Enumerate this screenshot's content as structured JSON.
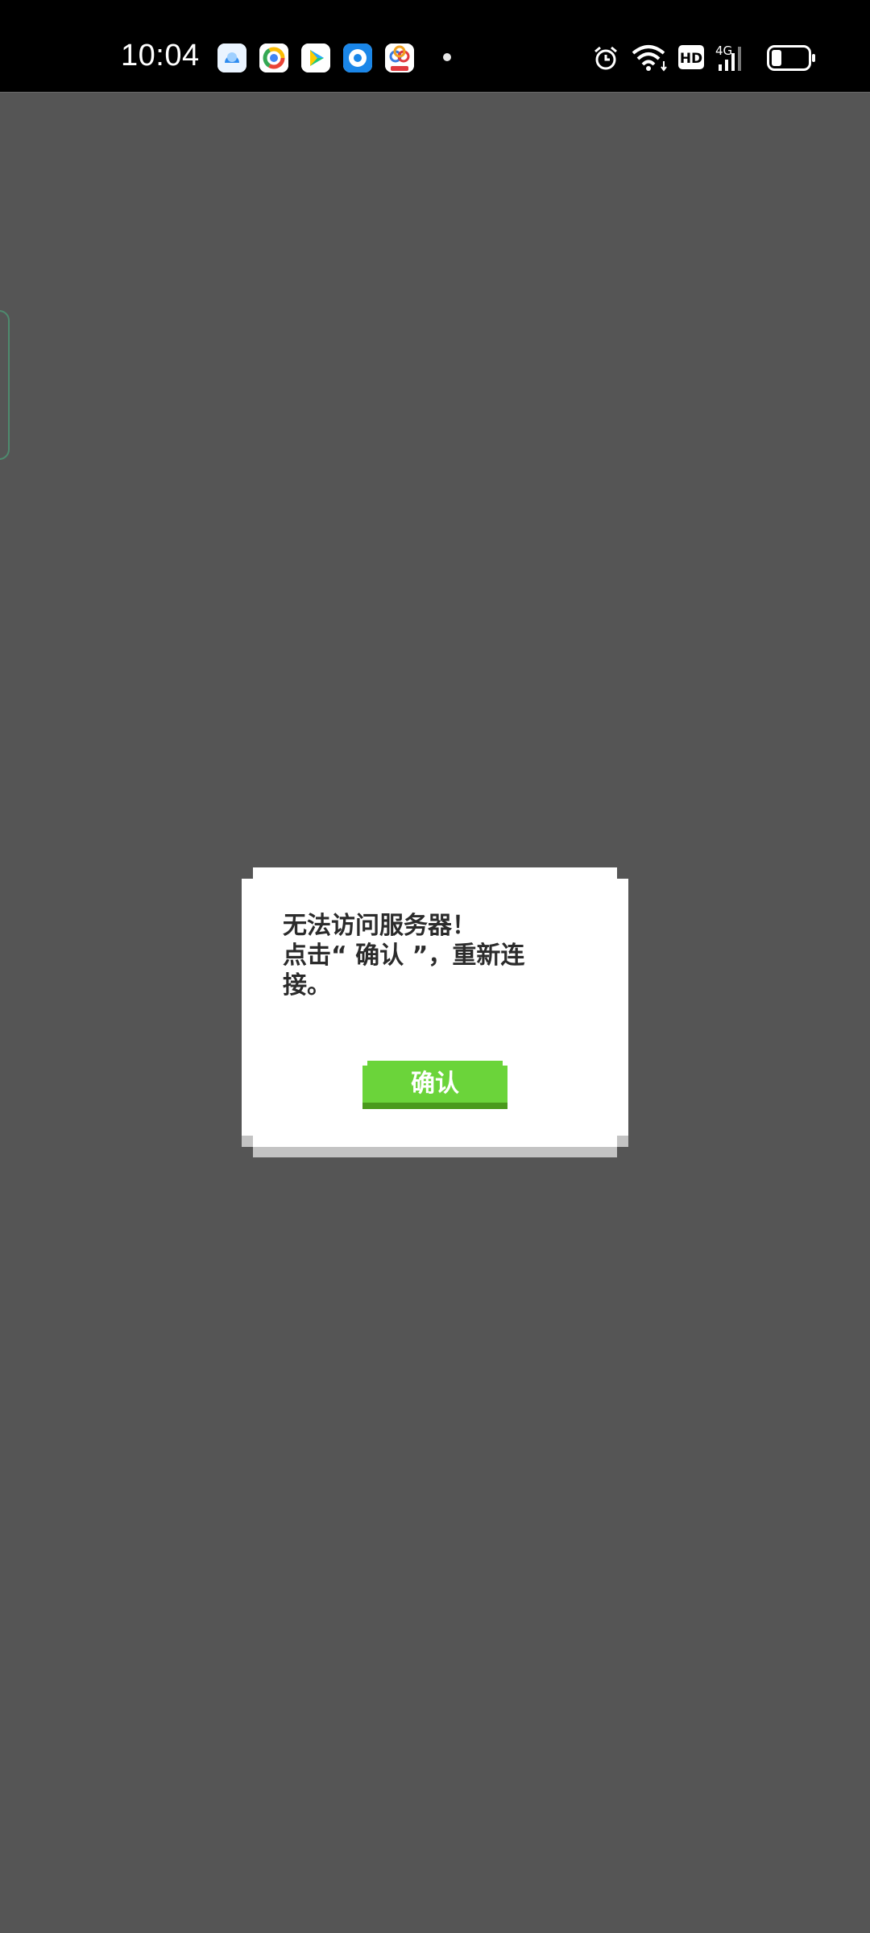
{
  "status_bar": {
    "time": "10:04",
    "notification_icons": [
      "cloud-app-icon",
      "browser-app-icon",
      "video-player-app-icon",
      "circle-app-icon",
      "shopping-app-icon"
    ],
    "indicator_icons": [
      "alarm-icon",
      "wifi-icon",
      "hd-icon",
      "4g-signal-icon",
      "battery-icon"
    ],
    "hd_label": "HD",
    "network_label": "4G"
  },
  "dialog": {
    "message": "无法访问服务器！\n点击“ 确认 ”，重新连\n接。",
    "confirm_label": "确认"
  },
  "colors": {
    "background": "#555555",
    "dialog_bg": "#ffffff",
    "dialog_shadow": "#c3c3c3",
    "button": "#6bd43a",
    "button_shadow": "#4a9a1c",
    "text": "#2b2b2b"
  }
}
